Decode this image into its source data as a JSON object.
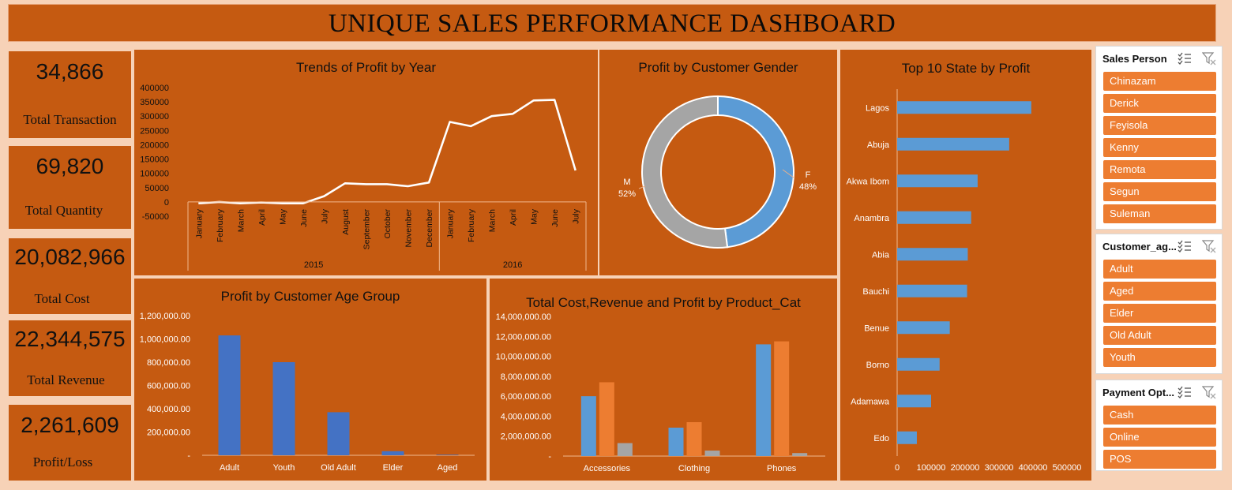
{
  "header": {
    "title": "UNIQUE SALES PERFORMANCE DASHBOARD"
  },
  "kpis": [
    {
      "value": "34,866",
      "label": "Total Transaction"
    },
    {
      "value": "69,820",
      "label": "Total Quantity"
    },
    {
      "value": "20,082,966",
      "label": "Total Cost"
    },
    {
      "value": "22,344,575",
      "label": "Total Revenue"
    },
    {
      "value": "2,261,609",
      "label": "Profit/Loss"
    }
  ],
  "colors": {
    "panel": "#c55a11",
    "background": "#f7d2b7",
    "blue": "#5b9bd5",
    "dark_blue": "#4472c4",
    "orange": "#ed7d31",
    "gray": "#a5a5a5",
    "line": "#ffffff"
  },
  "slicers": [
    {
      "title": "Sales Person",
      "items": [
        "Chinazam",
        "Derick",
        "Feyisola",
        "Kenny",
        "Remota",
        "Segun",
        "Suleman"
      ],
      "icons": [
        "multi-select-icon",
        "clear-filter-icon"
      ]
    },
    {
      "title": "Customer_ag...",
      "items": [
        "Adult",
        "Aged",
        "Elder",
        "Old Adult",
        "Youth"
      ],
      "icons": [
        "multi-select-icon",
        "clear-filter-icon"
      ]
    },
    {
      "title": "Payment Opt...",
      "items": [
        "Cash",
        "Online",
        "POS"
      ],
      "icons": [
        "multi-select-icon",
        "clear-filter-icon"
      ]
    }
  ],
  "chart_data": [
    {
      "type": "line",
      "title": "Trends of Profit by Year",
      "x": [
        "January",
        "February",
        "March",
        "April",
        "May",
        "June",
        "July",
        "August",
        "September",
        "October",
        "November",
        "December",
        "January",
        "February",
        "March",
        "April",
        "May",
        "June",
        "July"
      ],
      "groups": [
        {
          "label": "2015",
          "count": 12
        },
        {
          "label": "2016",
          "count": 7
        }
      ],
      "values": [
        -5000,
        0,
        -5000,
        -2000,
        -5000,
        -5000,
        20000,
        65000,
        62000,
        62000,
        55000,
        68000,
        280000,
        265000,
        300000,
        308000,
        355000,
        357000,
        110000
      ],
      "y_ticks": [
        "400000",
        "350000",
        "300000",
        "250000",
        "200000",
        "150000",
        "100000",
        "50000",
        "0",
        "-50000"
      ],
      "ylim": [
        -50000,
        400000
      ],
      "grid": false
    },
    {
      "type": "pie",
      "title": "Profit by Customer Gender",
      "categories": [
        "F",
        "M"
      ],
      "values": [
        48,
        52
      ],
      "labels": [
        "F\n48%",
        "M\n52%"
      ],
      "colors": [
        "#5b9bd5",
        "#a5a5a5"
      ]
    },
    {
      "type": "bar",
      "title": "Top 10 State by Profit",
      "orientation": "horizontal",
      "categories": [
        "Lagos",
        "Abuja",
        "Akwa Ibom",
        "Anambra",
        "Abia",
        "Bauchi",
        "Benue",
        "Borno",
        "Adamawa",
        "Edo"
      ],
      "values": [
        395000,
        330000,
        237000,
        218000,
        208000,
        206000,
        155000,
        125000,
        100000,
        58000
      ],
      "x_ticks": [
        "0",
        "100000",
        "200000",
        "300000",
        "400000",
        "500000"
      ],
      "xlim": [
        0,
        500000
      ]
    },
    {
      "type": "bar",
      "title": "Profit by Customer Age Group",
      "categories": [
        "Adult",
        "Youth",
        "Old Adult",
        "Elder",
        "Aged"
      ],
      "values": [
        1030000,
        800000,
        370000,
        35000,
        5000
      ],
      "y_ticks": [
        "1,200,000.00",
        "1,000,000.00",
        "800,000.00",
        "600,000.00",
        "400,000.00",
        "200,000.00",
        "-"
      ],
      "ylim": [
        0,
        1200000
      ]
    },
    {
      "type": "bar",
      "title": "Total Cost,Revenue and Profit by Product_Cat",
      "categories": [
        "Accessories",
        "Clothing",
        "Phones"
      ],
      "series": [
        {
          "values": [
            6000000,
            2850000,
            11200000
          ]
        },
        {
          "values": [
            7400000,
            3400000,
            11500000
          ]
        },
        {
          "values": [
            1300000,
            550000,
            300000
          ]
        }
      ],
      "series_colors": [
        "#5b9bd5",
        "#ed7d31",
        "#a5a5a5"
      ],
      "y_ticks": [
        "14,000,000.00",
        "12,000,000.00",
        "10,000,000.00",
        "8,000,000.00",
        "6,000,000.00",
        "4,000,000.00",
        "2,000,000.00",
        "-"
      ],
      "ylim": [
        0,
        14000000
      ]
    }
  ]
}
